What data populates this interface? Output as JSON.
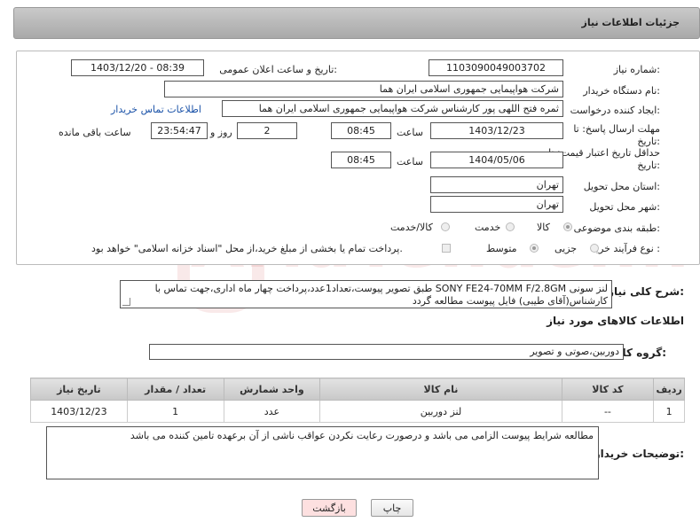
{
  "header": {
    "title": "جزئیات اطلاعات نیاز"
  },
  "form": {
    "need_number_label": "شماره نیاز:",
    "need_number": "1103090049003702",
    "announce_label": "تاریخ و ساعت اعلان عمومی:",
    "announce_value": "1403/12/20 - 08:39",
    "buyer_org_label": "نام دستگاه خریدار:",
    "buyer_org": "شرکت هواپیمایی جمهوری اسلامی ایران هما",
    "creator_label": "ایجاد کننده درخواست:",
    "creator": "ثمره فتح اللهی پور کارشناس شرکت هواپیمایی جمهوری اسلامی ایران هما",
    "contact_link": "اطلاعات تماس خریدار",
    "deadline_label": "مهلت ارسال پاسخ: تا تاریخ:",
    "deadline_date": "1403/12/23",
    "time_label": "ساعت",
    "deadline_time": "08:45",
    "days_value": "2",
    "days_label": "روز و",
    "remaining_value": "23:54:47",
    "remaining_label": "ساعت باقی مانده",
    "price_label": "حداقل تاریخ اعتبار قیمت: تا تاریخ:",
    "price_date": "1404/05/06",
    "price_time": "08:45",
    "province_label": "استان محل تحویل:",
    "province": "تهران",
    "city_label": "شهر محل تحویل:",
    "city": "تهران",
    "category_label": "طبقه بندی موضوعی:",
    "category_options": [
      "کالا",
      "خدمت",
      "کالا/خدمت"
    ],
    "process_label": "نوع فرآیند خرید :",
    "process_options": [
      "جزیی",
      "متوسط"
    ],
    "payment_note": "پرداخت تمام یا بخشی از مبلغ خرید،از محل \"اسناد خزانه اسلامی\" خواهد بود."
  },
  "description": {
    "label": "شرح کلی نیاز:",
    "text": "لنز سونی SONY FE24-70MM F/2.8GM طبق تصویر پیوست،تعداد1عدد،پرداخت چهار ماه اداری،جهت تماس با کارشناس(آقای طیبی) فایل پیوست مطالعه گردد"
  },
  "goods_section": {
    "title": "اطلاعات کالاهای مورد نیاز",
    "group_label": "گروه کالا:",
    "group_value": "دوربین،صوتی و تصویر"
  },
  "table": {
    "headers": [
      "ردیف",
      "کد کالا",
      "نام کالا",
      "واحد شمارش",
      "تعداد / مقدار",
      "تاریخ نیاز"
    ],
    "rows": [
      [
        "1",
        "--",
        "لنز دوربین",
        "عدد",
        "1",
        "1403/12/23"
      ]
    ]
  },
  "buyer_notes": {
    "label": "توضیحات خریدار:",
    "text": "مطالعه شرایط پیوست الزامی می باشد و درصورت رعایت نکردن عواقب ناشی از آن برعهده تامین کننده می باشد"
  },
  "buttons": {
    "print": "چاپ",
    "back": "بازگشت"
  },
  "watermark": {
    "text": "AriaTender.neT"
  },
  "colors": {
    "link": "#1a52a8",
    "back_button_bg": "#fde0e0",
    "watermark": "#c82828"
  }
}
